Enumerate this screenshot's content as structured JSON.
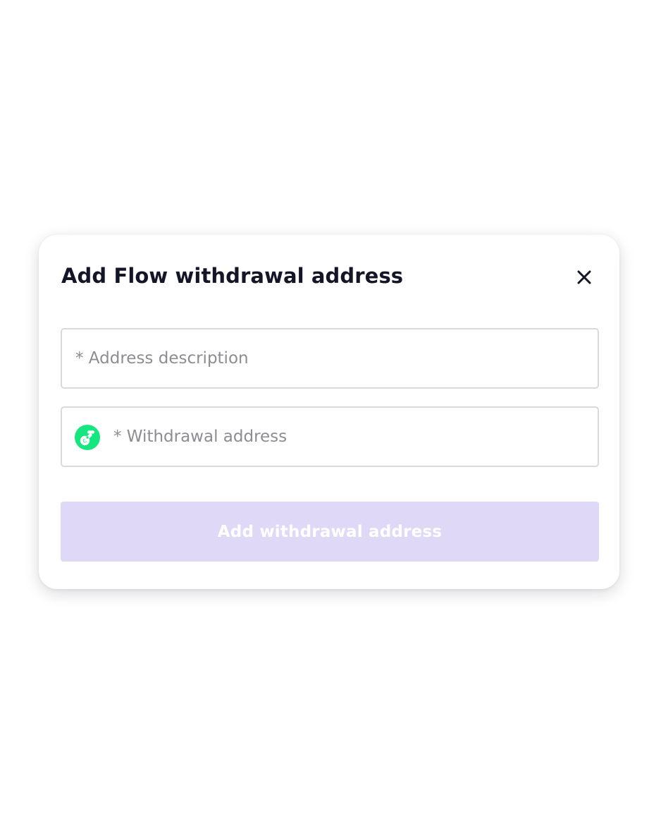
{
  "modal": {
    "title": "Add Flow withdrawal address",
    "close_icon": "close-icon",
    "fields": {
      "description": {
        "placeholder": "* Address description",
        "value": ""
      },
      "address": {
        "icon": "flow-logo-icon",
        "placeholder": "* Withdrawal address",
        "value": ""
      }
    },
    "submit_label": "Add withdrawal address",
    "submit_disabled": true
  },
  "colors": {
    "title": "#141627",
    "placeholder": "#8c8c93",
    "field_border": "#d9d9de",
    "button_disabled_bg": "#dfd9f7",
    "button_text": "#ffffff",
    "flow_green": "#16e67f"
  }
}
